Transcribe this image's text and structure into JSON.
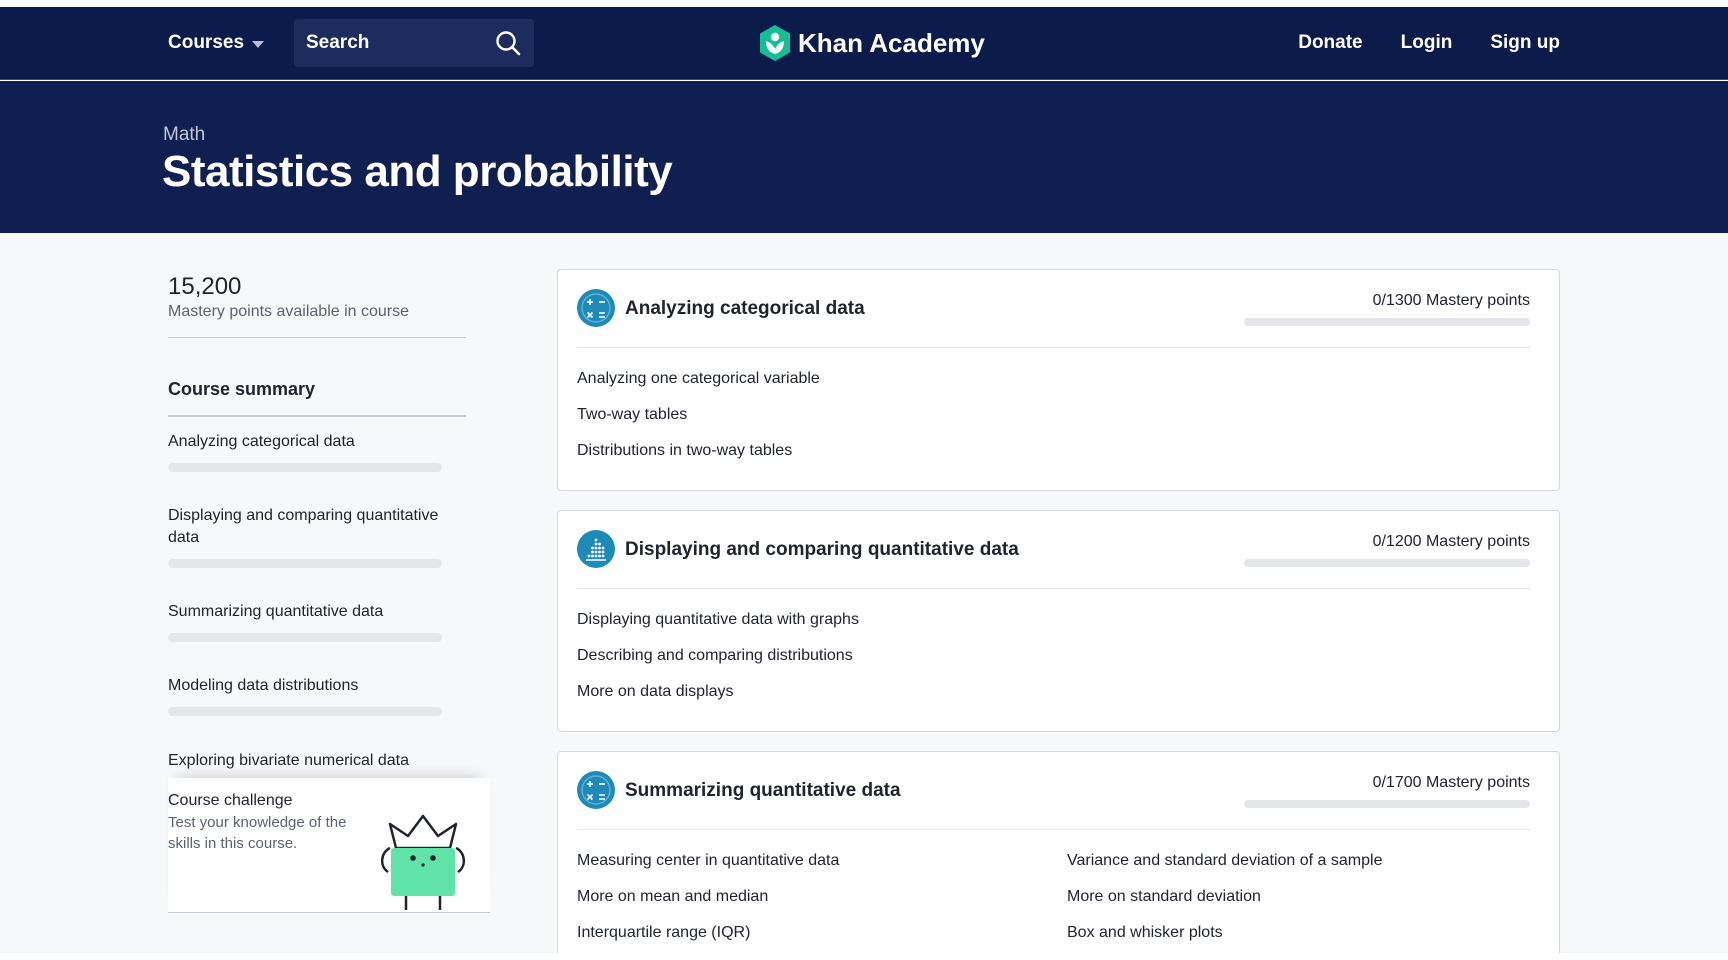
{
  "nav": {
    "courses_label": "Courses",
    "search_label": "Search",
    "logo_text": "Khan Academy",
    "donate": "Donate",
    "login": "Login",
    "signup": "Sign up"
  },
  "hero": {
    "breadcrumb": "Math",
    "title": "Statistics and probability"
  },
  "sidebar": {
    "points_value": "15,200",
    "points_label": "Mastery points available in course",
    "summary_heading": "Course summary",
    "items": [
      {
        "label": "Analyzing categorical data",
        "progress": 0
      },
      {
        "label": "Displaying and comparing quantitative data",
        "progress": 0
      },
      {
        "label": "Summarizing quantitative data",
        "progress": 0
      },
      {
        "label": "Modeling data distributions",
        "progress": 0
      },
      {
        "label": "Exploring bivariate numerical data",
        "progress": 0
      }
    ],
    "challenge": {
      "title": "Course challenge",
      "description": "Test your knowledge of the skills in this course."
    }
  },
  "units": [
    {
      "title": "Analyzing categorical data",
      "mastery": "0/1300 Mastery points",
      "progress": 0,
      "lessons": [
        "Analyzing one categorical variable",
        "Two-way tables",
        "Distributions in two-way tables"
      ]
    },
    {
      "title": "Displaying and comparing quantitative data",
      "mastery": "0/1200 Mastery points",
      "progress": 0,
      "lessons": [
        "Displaying quantitative data with graphs",
        "Describing and comparing distributions",
        "More on data displays"
      ]
    },
    {
      "title": "Summarizing quantitative data",
      "mastery": "0/1700 Mastery points",
      "progress": 0,
      "lessons": [
        "Measuring center in quantitative data",
        "More on mean and median",
        "Interquartile range (IQR)",
        "Variance and standard deviation of a sample",
        "More on standard deviation",
        "Box and whisker plots"
      ]
    }
  ],
  "colors": {
    "nav_bg": "#0b1c4b",
    "hero_bg": "#0f1f4f",
    "unit_icon": "#1e8ab8",
    "logo_green": "#14bf96",
    "challenge_green": "#5fe3a6"
  }
}
